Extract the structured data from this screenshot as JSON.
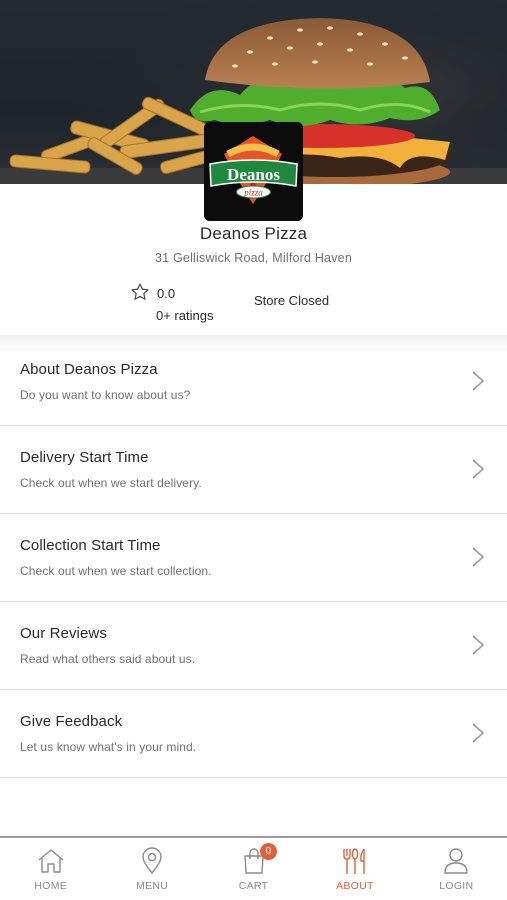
{
  "store": {
    "name": "Deanos Pizza",
    "address": "31 Gelliswick Road, Milford Haven",
    "rating_value": "0.0",
    "rating_count": "0+ ratings",
    "status": "Store Closed",
    "logo_text": "Deanos",
    "logo_subtext": "pizza"
  },
  "menu_items": [
    {
      "title": "About Deanos Pizza",
      "subtitle": "Do you want to know about us?"
    },
    {
      "title": "Delivery Start Time",
      "subtitle": "Check out when we start delivery."
    },
    {
      "title": "Collection Start Time",
      "subtitle": "Check out when we start collection."
    },
    {
      "title": "Our Reviews",
      "subtitle": "Read what others said about us."
    },
    {
      "title": "Give Feedback",
      "subtitle": "Let us know what's in your mind."
    }
  ],
  "nav": {
    "home": "HOME",
    "menu": "MENU",
    "cart": "CART",
    "cart_count": "0",
    "about": "ABOUT",
    "login": "LOGIN",
    "active": "about"
  },
  "icons": {
    "home": "home-icon",
    "menu": "location-pin-icon",
    "cart": "shopping-bag-icon",
    "about": "fork-knife-icon",
    "login": "user-icon",
    "rating": "star-outline-icon",
    "chevron": "chevron-right-icon"
  },
  "colors": {
    "accent": "#e0603a",
    "text": "#2a2a2a",
    "muted": "#707070",
    "divider": "#d9d9d9"
  }
}
